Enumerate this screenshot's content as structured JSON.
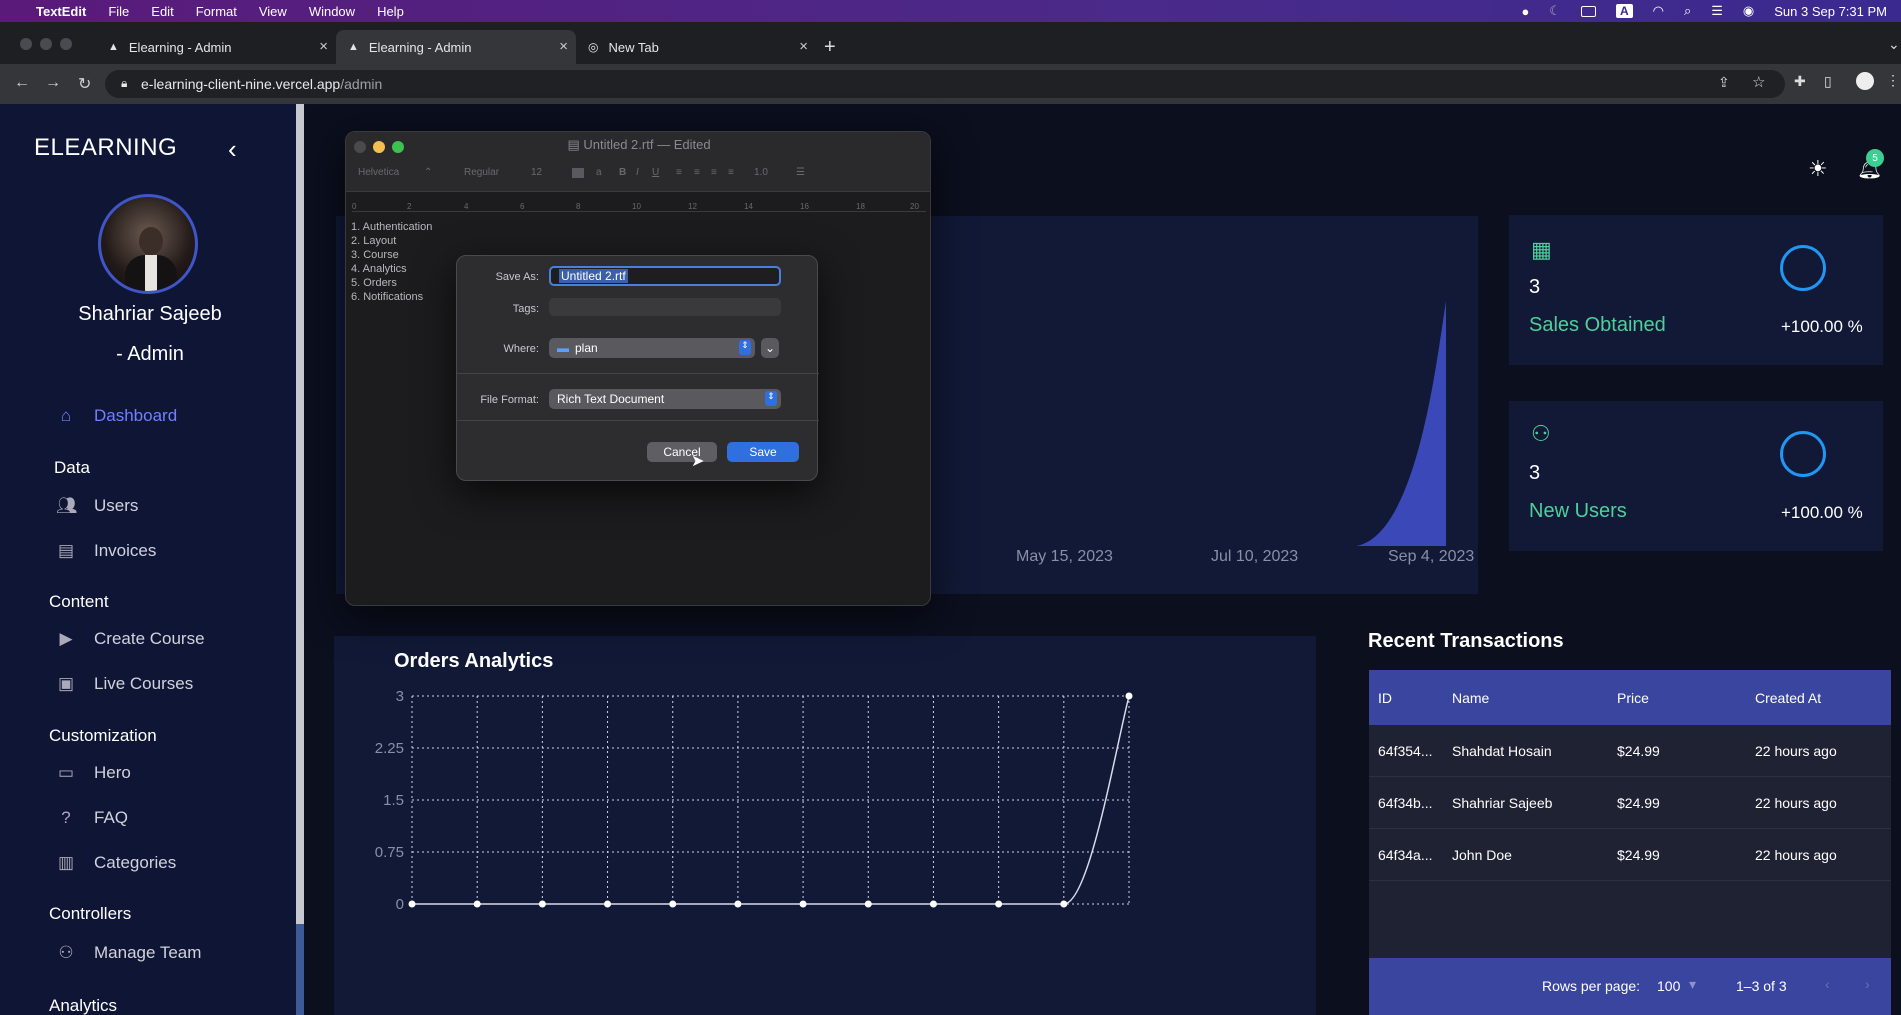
{
  "menubar": {
    "app_name": "TextEdit",
    "menus": [
      "File",
      "Edit",
      "Format",
      "View",
      "Window",
      "Help"
    ],
    "clock": "Sun 3 Sep  7:31 PM",
    "input_source": "A"
  },
  "browser": {
    "tabs": [
      {
        "label": "Elearning - Admin"
      },
      {
        "label": "Elearning - Admin"
      },
      {
        "label": "New Tab"
      }
    ],
    "url_host": "e-learning-client-nine.vercel.app",
    "url_path": "/admin"
  },
  "sidebar": {
    "brand": "ELEARNING",
    "user_name": "Shahriar Sajeeb",
    "user_role": "- Admin",
    "nav": {
      "dashboard": "Dashboard",
      "data": "Data",
      "users": "Users",
      "invoices": "Invoices",
      "content": "Content",
      "create_course": "Create Course",
      "live_courses": "Live Courses",
      "customization": "Customization",
      "hero": "Hero",
      "faq": "FAQ",
      "categories": "Categories",
      "controllers": "Controllers",
      "manage_team": "Manage Team",
      "analytics": "Analytics"
    }
  },
  "header": {
    "notification_count": "5"
  },
  "kpis": [
    {
      "value": "3",
      "label": "Sales Obtained",
      "change": "+100.00 %"
    },
    {
      "value": "3",
      "label": "New Users",
      "change": "+100.00 %"
    }
  ],
  "area_chart": {
    "x_ticks": [
      "May 15, 2023",
      "Jul 10, 2023",
      "Sep 4, 2023"
    ]
  },
  "orders": {
    "title": "Orders Analytics"
  },
  "chart_data": {
    "type": "line",
    "title": "Orders Analytics",
    "y_ticks": [
      "3",
      "2.25",
      "1.5",
      "0.75",
      "0"
    ],
    "ylim": [
      0,
      3
    ],
    "values": [
      0,
      0,
      0,
      0,
      0,
      0,
      0,
      0,
      0,
      0,
      0,
      3
    ],
    "grid": true
  },
  "transactions": {
    "title": "Recent Transactions",
    "columns": [
      "ID",
      "Name",
      "Price",
      "Created At"
    ],
    "rows": [
      [
        "64f354...",
        "Shahdat Hosain",
        "$24.99",
        "22 hours ago"
      ],
      [
        "64f34b...",
        "Shahriar Sajeeb",
        "$24.99",
        "22 hours ago"
      ],
      [
        "64f34a...",
        "John Doe",
        "$24.99",
        "22 hours ago"
      ]
    ],
    "rows_per_page_label": "Rows per page:",
    "rows_per_page": "100",
    "range": "1–3 of 3"
  },
  "textedit": {
    "window_title": "Untitled 2.rtf",
    "edited": "— Edited",
    "font": "Helvetica",
    "style": "Regular",
    "size": "12",
    "spacing": "1.0",
    "document_lines": [
      "1. Authentication",
      "2. Layout",
      "3. Course",
      "4. Analytics",
      "5. Orders",
      "6. Notifications"
    ],
    "ruler_marks": [
      "0",
      "2",
      "4",
      "6",
      "8",
      "10",
      "12",
      "14",
      "16",
      "18",
      "20"
    ]
  },
  "save_dialog": {
    "save_as_label": "Save As:",
    "save_as_value": "Untitled 2.rtf",
    "tags_label": "Tags:",
    "where_label": "Where:",
    "where_value": "plan",
    "format_label": "File Format:",
    "format_value": "Rich Text Document",
    "cancel": "Cancel",
    "save": "Save"
  },
  "colors": {
    "accent": "#3a45a0",
    "kpi_label": "#4ecf9b",
    "active_nav": "#7080ff",
    "area_fill": "#3b48b8"
  }
}
